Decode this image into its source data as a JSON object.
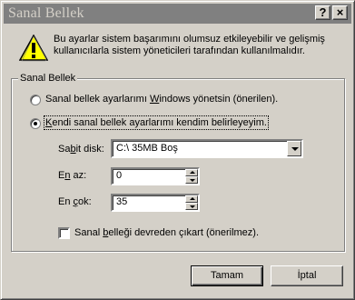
{
  "window": {
    "title": "Sanal Bellek",
    "help_label": "?",
    "close_label": "×"
  },
  "warning": {
    "icon": "warning-icon",
    "message": "Bu ayarlar sistem başarımını olumsuz etkileyebilir ve gelişmiş kullanıcılarla sistem yöneticileri tarafından kullanılmalıdır."
  },
  "group": {
    "label": "Sanal Bellek",
    "option_windows_pre": "Sanal bellek ayarlarımı ",
    "option_windows_ul": "W",
    "option_windows_post": "indows yönetsin (önerilen).",
    "option_custom_ul": "K",
    "option_custom_post": "endi sanal bellek ayarlarımı kendim belirleyeyim.",
    "option_selected": "custom",
    "disk_label_pre": "Sa",
    "disk_label_ul": "b",
    "disk_label_post": "it disk:",
    "disk_value": "C:\\ 35MB Boş",
    "min_label_pre": "E",
    "min_label_ul": "n",
    "min_label_post": " az:",
    "min_value": "0",
    "max_label_pre": "En ",
    "max_label_ul": "ç",
    "max_label_post": "ok:",
    "max_value": "35",
    "disable_pre": "Sanal ",
    "disable_ul": "b",
    "disable_post": "elleği devreden çıkart (önerilmez).",
    "disable_checked": false
  },
  "buttons": {
    "ok": "Tamam",
    "cancel": "İptal"
  }
}
